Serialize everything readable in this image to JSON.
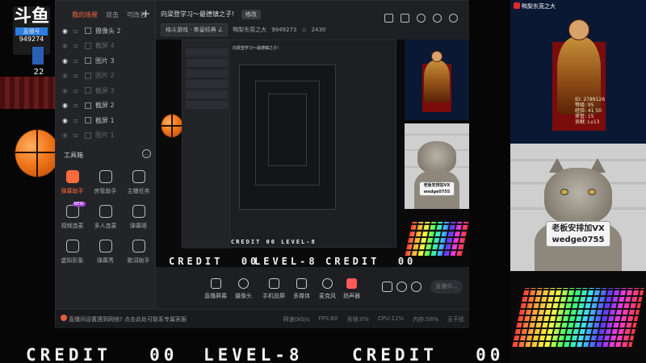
{
  "watermark": {
    "logo": "斗鱼",
    "sub": "直播号",
    "room": "949274",
    "count": "22"
  },
  "arcade": {
    "credit": "CREDIT",
    "credit_val": "00",
    "level": "LEVEL-8"
  },
  "left_panel": {
    "tabs": [
      "我的场景",
      "双击",
      "可改名"
    ],
    "add": "+",
    "scenes": [
      {
        "label": "摄像头 2",
        "dim": false
      },
      {
        "label": "截屏 4",
        "dim": true
      },
      {
        "label": "图片 3",
        "dim": false
      },
      {
        "label": "图片 2",
        "dim": true
      },
      {
        "label": "截屏 3",
        "dim": true
      },
      {
        "label": "截屏 2",
        "dim": false
      },
      {
        "label": "截屏 1",
        "dim": false
      },
      {
        "label": "图片 1",
        "dim": true
      }
    ],
    "toolbox_title": "工具箱",
    "toolbox_more": "...",
    "tools": [
      {
        "label": "弹幕助手",
        "hot": true,
        "badge": ""
      },
      {
        "label": "房管助手",
        "hot": false,
        "badge": ""
      },
      {
        "label": "主播任务",
        "hot": false,
        "badge": ""
      },
      {
        "label": "视频连麦",
        "hot": false,
        "badge": "NEW"
      },
      {
        "label": "多人连麦",
        "hot": false,
        "badge": ""
      },
      {
        "label": "弹幕姬",
        "hot": false,
        "badge": ""
      },
      {
        "label": "虚拟形象",
        "hot": false,
        "badge": ""
      },
      {
        "label": "弹幕秀",
        "hot": false,
        "badge": ""
      },
      {
        "label": "歌词助手",
        "hot": false,
        "badge": ""
      }
    ]
  },
  "header": {
    "title": "向梁登学习～最德镇之子!",
    "edit": "修改",
    "category": "格斗游戏 · 拳皇经典 ∠",
    "owner": "鸭梨东莞之大",
    "room_id": "9949273",
    "heat": "2430"
  },
  "controls": [
    {
      "label": "直播屏幕"
    },
    {
      "label": "摄像头"
    },
    {
      "label": "手机投屏"
    },
    {
      "label": "多媒体"
    },
    {
      "label": "麦克风"
    },
    {
      "label": "扬声器"
    }
  ],
  "go_live": "直播中...",
  "status": {
    "tip": "直播间设置遇到网络? 点击此处可联系专属客服",
    "stats": [
      "网速0kb/s",
      "FPS:60",
      "丢帧:0%",
      "CPU:11%",
      "内存:58%",
      "无干扰"
    ]
  },
  "streamer": {
    "title": "鸭梨东莞之大",
    "stats": [
      "ID: 2789126",
      "等级: 95",
      "经验: 41 50",
      "荣誉: 15",
      "贡献: Lv13"
    ]
  },
  "cat_sign": {
    "line1": "老板安排加VX",
    "line2": "wedge0755"
  },
  "mini": {
    "title": "向梁登学习～最德镇之子!"
  }
}
